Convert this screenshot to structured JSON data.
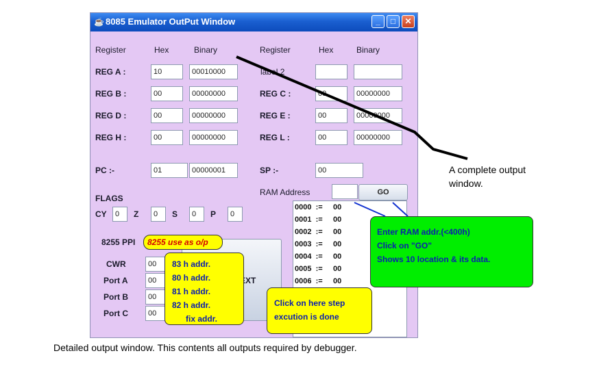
{
  "window": {
    "title": "8085 Emulator  OutPut  Window",
    "app_icon": "java-cup-icon",
    "controls": {
      "minimize": "_",
      "maximize": "□",
      "close": "✕"
    }
  },
  "headers": {
    "left": {
      "register": "Register",
      "hex": "Hex",
      "binary": "Binary"
    },
    "right": {
      "register": "Register",
      "hex": "Hex",
      "binary": "Binary"
    }
  },
  "registers": {
    "A": {
      "label": "REG    A :",
      "hex": "10",
      "binary": "00010000"
    },
    "B": {
      "label": "REG    B :",
      "hex": "00",
      "binary": "00000000"
    },
    "D": {
      "label": "REG    D :",
      "hex": "00",
      "binary": "00000000"
    },
    "H": {
      "label": "REG    H :",
      "hex": "00",
      "binary": "00000000"
    },
    "label2": {
      "label": "label  2",
      "hex": "",
      "binary": ""
    },
    "C": {
      "label": "REG    C :",
      "hex": "00",
      "binary": "00000000"
    },
    "E": {
      "label": "REG    E :",
      "hex": "00",
      "binary": "00000000"
    },
    "L": {
      "label": "REG    L :",
      "hex": "00",
      "binary": "00000000"
    }
  },
  "pc": {
    "label": "PC :-",
    "hex": "01",
    "binary": "00000001"
  },
  "sp": {
    "label": "SP :-",
    "hex": "00"
  },
  "ram": {
    "label": "RAM Address",
    "address_value": "",
    "go_label": "GO",
    "rows": [
      "0000  :=     00",
      "0001  :=     00",
      "0002  :=     00",
      "0003  :=     00",
      "0004  :=     00",
      "0005  :=     00",
      "0006  :=     00"
    ]
  },
  "flags": {
    "title": "FLAGS",
    "items": [
      {
        "name": "CY",
        "value": "0"
      },
      {
        "name": "Z",
        "value": "0"
      },
      {
        "name": "S",
        "value": "0"
      },
      {
        "name": "P",
        "value": "0"
      }
    ]
  },
  "ppi": {
    "title": "8255  PPI",
    "note": "8255  use as o/p",
    "ports": [
      {
        "name": "CWR",
        "value": "00"
      },
      {
        "name": "Port A",
        "value": "00"
      },
      {
        "name": "Port B",
        "value": "00"
      },
      {
        "name": "Port C",
        "value": "00"
      }
    ],
    "addr_lines": [
      "83 h addr.",
      "80 h addr.",
      "81 h addr.",
      "82 h addr.",
      "fix addr."
    ]
  },
  "next_button": {
    "label_visible": "EXT"
  },
  "annotations": {
    "complete": "A complete output window.",
    "complete_line1": "A complete output",
    "complete_line2": "window.",
    "ram_help": [
      "Enter RAM addr.(<400h)",
      "Click on \"GO\"",
      "Shows 10 location & its data."
    ],
    "step_help": [
      "Click on here step",
      "excution is done"
    ],
    "caption": "Detailed output window. This contents all outputs required by debugger."
  },
  "colors": {
    "window_bg": "#e4c8f4",
    "titlebar": "#1a5fd0",
    "callout_yellow": "#ffff00",
    "callout_green": "#00ee00",
    "callout_text": "#0b1fae",
    "ppi_note_text": "#d40000"
  }
}
